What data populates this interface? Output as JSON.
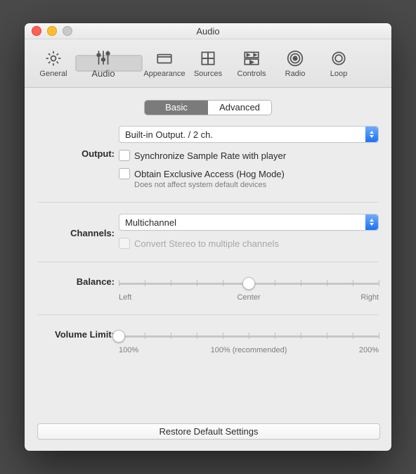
{
  "window": {
    "title": "Audio"
  },
  "toolbar": {
    "items": [
      {
        "id": "general",
        "label": "General"
      },
      {
        "id": "audio",
        "label": "Audio"
      },
      {
        "id": "appearance",
        "label": "Appearance"
      },
      {
        "id": "sources",
        "label": "Sources"
      },
      {
        "id": "controls",
        "label": "Controls"
      },
      {
        "id": "radio",
        "label": "Radio"
      },
      {
        "id": "loop",
        "label": "Loop"
      }
    ],
    "selected": "audio"
  },
  "segmented": {
    "basic": "Basic",
    "advanced": "Advanced",
    "active": "basic"
  },
  "output": {
    "label": "Output:",
    "device": "Built-in Output. / 2 ch.",
    "sync_label": "Synchronize Sample Rate with player",
    "hog_label": "Obtain Exclusive Access (Hog Mode)",
    "hog_hint": "Does not affect system default devices"
  },
  "channels": {
    "label": "Channels:",
    "mode": "Multichannel",
    "convert_label": "Convert Stereo to multiple channels"
  },
  "balance": {
    "label": "Balance:",
    "left": "Left",
    "center": "Center",
    "right": "Right",
    "value_pct": 50
  },
  "volume_limit": {
    "label": "Volume Limit:",
    "min": "100%",
    "rec": "100% (recommended)",
    "max": "200%",
    "value_pct": 0
  },
  "footer": {
    "restore": "Restore Default Settings"
  }
}
